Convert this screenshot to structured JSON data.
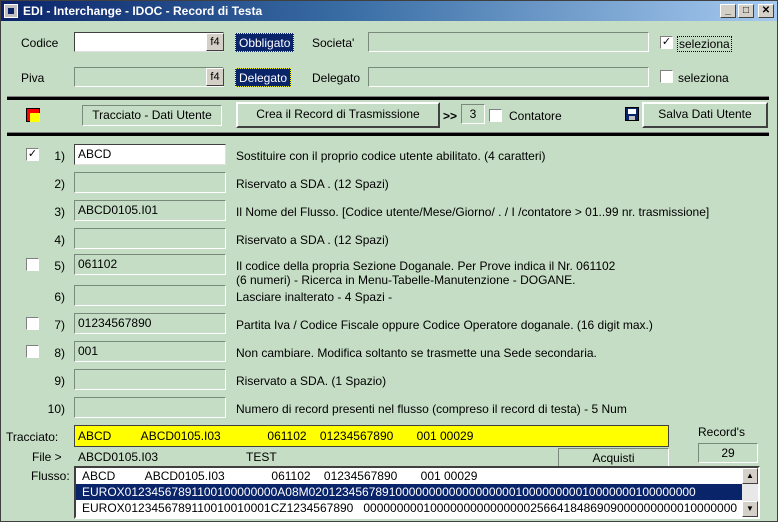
{
  "window": {
    "title": "EDI - Interchange - IDOC - Record di Testa"
  },
  "header": {
    "codice_label": "Codice",
    "codice_value": "",
    "f4": "f4",
    "obbligato": "Obbligato",
    "societa_label": "Societa'",
    "societa_value": "",
    "seleziona1": "seleziona",
    "piva_label": "Piva",
    "piva_value": "",
    "delegato_tag": "Delegato",
    "delegato_label": "Delegato",
    "delegato_value": "",
    "seleziona2": "seleziona"
  },
  "toolbar": {
    "tracciato_btn": "Tracciato - Dati Utente",
    "crea_btn": "Crea il Record di Trasmissione",
    "arrows": ">>",
    "contatore_value": "3",
    "contatore_label": "Contatore",
    "salva_btn": "Salva Dati Utente"
  },
  "rows": [
    {
      "num": "1)",
      "value": "ABCD",
      "desc": "Sostituire con il proprio codice utente abilitato. (4 caratteri)",
      "desc2": ""
    },
    {
      "num": "2)",
      "value": "",
      "desc": "Riservato a  SDA . (12 Spazi)",
      "desc2": ""
    },
    {
      "num": "3)",
      "value": "ABCD0105.I01",
      "desc": "Il Nome del Flusso. [Codice utente/Mese/Giorno/ . / I /contatore > 01..99  nr. trasmissione]",
      "desc2": ""
    },
    {
      "num": "4)",
      "value": "",
      "desc": "Riservato a  SDA . (12 Spazi)",
      "desc2": ""
    },
    {
      "num": "5)",
      "value": "061102",
      "desc": "Il codice della propria Sezione Doganale. Per Prove indica il Nr.  061102",
      "desc2": "(6 numeri) - Ricerca in Menu-Tabelle-Manutenzione - DOGANE."
    },
    {
      "num": "6)",
      "value": "",
      "desc": "Lasciare inalterato - 4 Spazi -",
      "desc2": ""
    },
    {
      "num": "7)",
      "value": "01234567890",
      "desc": "Partita Iva / Codice Fiscale oppure Codice  Operatore doganale. (16 digit max.)",
      "desc2": ""
    },
    {
      "num": "8)",
      "value": "001",
      "desc": "Non cambiare.  Modifica soltanto se trasmette una Sede secondaria.",
      "desc2": ""
    },
    {
      "num": "9)",
      "value": "",
      "desc": "Riservato a  SDA. (1 Spazio)",
      "desc2": ""
    },
    {
      "num": "10)",
      "value": "",
      "desc": "Numero di record presenti nel flusso (compreso il record di testa) - 5 Num",
      "desc2": ""
    }
  ],
  "bottom": {
    "tracciato_label": "Tracciato:",
    "tracciato_value": "ABCD         ABCD0105.I03              061102    01234567890       001 00029",
    "records_label": "Record's",
    "records_value": "29",
    "file_label": "File >",
    "file_name": "ABCD0105.I03",
    "file_test": "TEST",
    "acquisti_btn": "Acquisti",
    "flusso_label": "Flusso:",
    "flusso_items": [
      "ABCD         ABCD0105.I03              061102    01234567890       001 00029",
      "EUROX01234567891100100000000A08M0201234567891000000000000000000100000000010000000100000000",
      "EUROX0123456789110010010001CZ1234567890   00000000010000000000000002566418486909000000000010000000"
    ]
  },
  "checks": {
    "seleziona1": "✓",
    "row1": "✓"
  }
}
